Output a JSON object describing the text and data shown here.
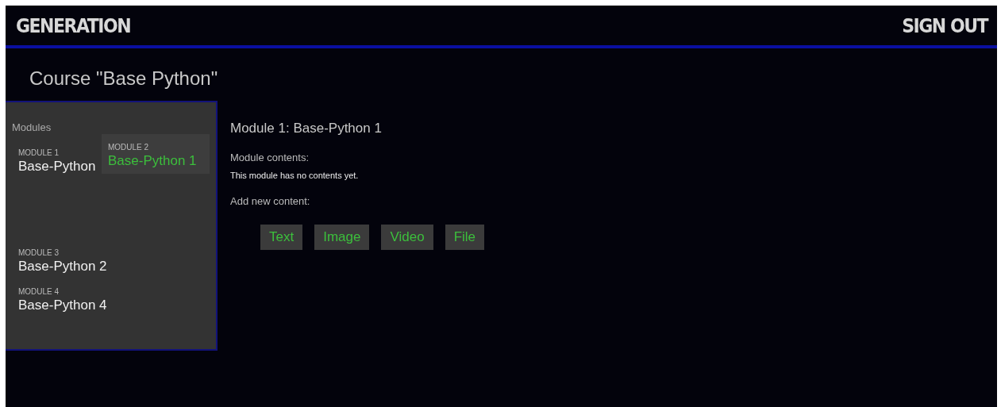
{
  "header": {
    "brand": "GENERATION",
    "sign_out": "SIGN OUT"
  },
  "course_title": "Course \"Base Python\"",
  "modules_panel": {
    "heading": "Modules",
    "items": [
      {
        "label": "MODULE 1",
        "title": "Base-Python",
        "dragging": false
      },
      {
        "label": "MODULE 2",
        "title": "Base-Python 1",
        "dragging": true
      },
      {
        "label": "MODULE 3",
        "title": "Base-Python 2",
        "dragging": false
      },
      {
        "label": "MODULE 4",
        "title": "Base-Python 4",
        "dragging": false
      }
    ]
  },
  "detail": {
    "title": "Module 1: Base-Python 1",
    "contents_label": "Module contents:",
    "empty_note": "This module has no contents yet.",
    "add_label": "Add new content:",
    "buttons": [
      "Text",
      "Image",
      "Video",
      "File"
    ]
  }
}
